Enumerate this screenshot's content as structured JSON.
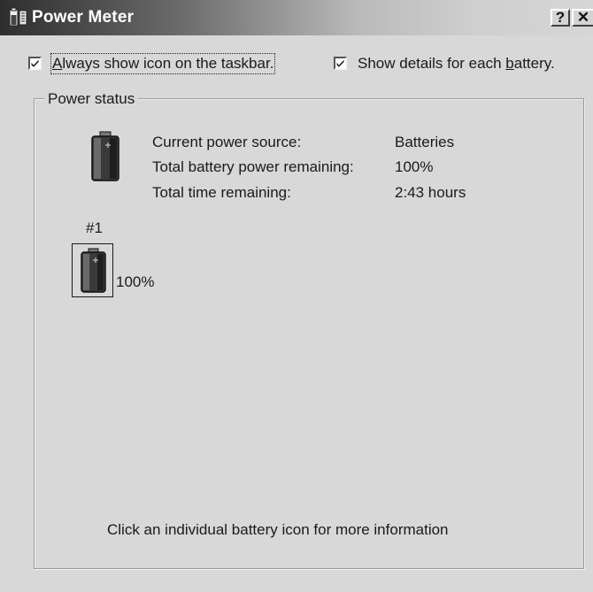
{
  "window": {
    "title": "Power Meter",
    "help_label": "?",
    "close_label": "✕"
  },
  "options": {
    "always_show_icon": {
      "label_underline": "A",
      "label_rest": "lways show icon on the taskbar.",
      "checked": true
    },
    "show_details": {
      "label_prefix": "Show details for each ",
      "label_underline": "b",
      "label_suffix": "attery.",
      "checked": true
    }
  },
  "power_status": {
    "group_title": "Power status",
    "rows": [
      {
        "label": "Current power source:",
        "value": "Batteries"
      },
      {
        "label": "Total battery power remaining:",
        "value": "100%"
      },
      {
        "label": "Total time remaining:",
        "value": "2:43 hours"
      }
    ]
  },
  "batteries": [
    {
      "number": "#1",
      "percent": "100%",
      "level": 1.0
    }
  ],
  "footer": {
    "hint": "Click an individual battery icon for more information"
  },
  "icons": {
    "app": "power-meter-icon",
    "status_battery": "battery-icon",
    "battery_item": "battery-icon"
  }
}
